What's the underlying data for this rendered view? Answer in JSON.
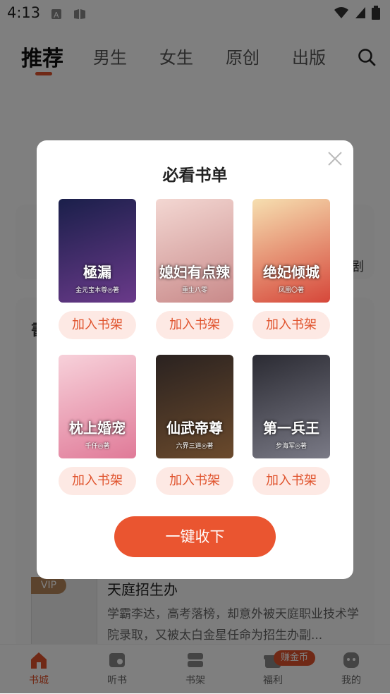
{
  "status": {
    "time": "4:13"
  },
  "tabs": [
    {
      "label": "推荐"
    },
    {
      "label": "男生"
    },
    {
      "label": "女生"
    },
    {
      "label": "原创"
    },
    {
      "label": "出版"
    }
  ],
  "background": {
    "side_right_label": "剧",
    "section_initial": "書",
    "book_badge": "VIP",
    "book_title": "天庭招生办",
    "book_desc": "学霸李达，高考落榜，却意外被天庭职业技术学院录取，又被太白金星任命为招生办副..."
  },
  "bottom_nav": {
    "items": [
      {
        "label": "书城"
      },
      {
        "label": "听书"
      },
      {
        "label": "书架"
      },
      {
        "label": "福利"
      },
      {
        "label": "我的"
      }
    ],
    "earn_badge": "赚金币"
  },
  "dialog": {
    "title": "必看书单",
    "add_label": "加入书架",
    "books": [
      {
        "cover_title": "極漏",
        "cover_sub": "金元宝本尊◎著",
        "colors": [
          "#1a1f4a",
          "#6a3a8a"
        ]
      },
      {
        "cover_title": "媳妇有点辣",
        "cover_sub": "重生八零",
        "colors": [
          "#f3d7d2",
          "#c98a8a"
        ]
      },
      {
        "cover_title": "绝妃倾城",
        "cover_sub": "凤凰〇著",
        "colors": [
          "#f6dfb0",
          "#d6473a"
        ]
      },
      {
        "cover_title": "枕上婚宠",
        "cover_sub": "千仟◎著",
        "colors": [
          "#f7d1da",
          "#e07a98"
        ]
      },
      {
        "cover_title": "仙武帝尊",
        "cover_sub": "六界三道◎著",
        "colors": [
          "#2a2220",
          "#6b4a2c"
        ]
      },
      {
        "cover_title": "第一兵王",
        "cover_sub": "步海军◎著",
        "colors": [
          "#2b2b33",
          "#7a7a86"
        ]
      }
    ],
    "collect_label": "一键收下"
  }
}
